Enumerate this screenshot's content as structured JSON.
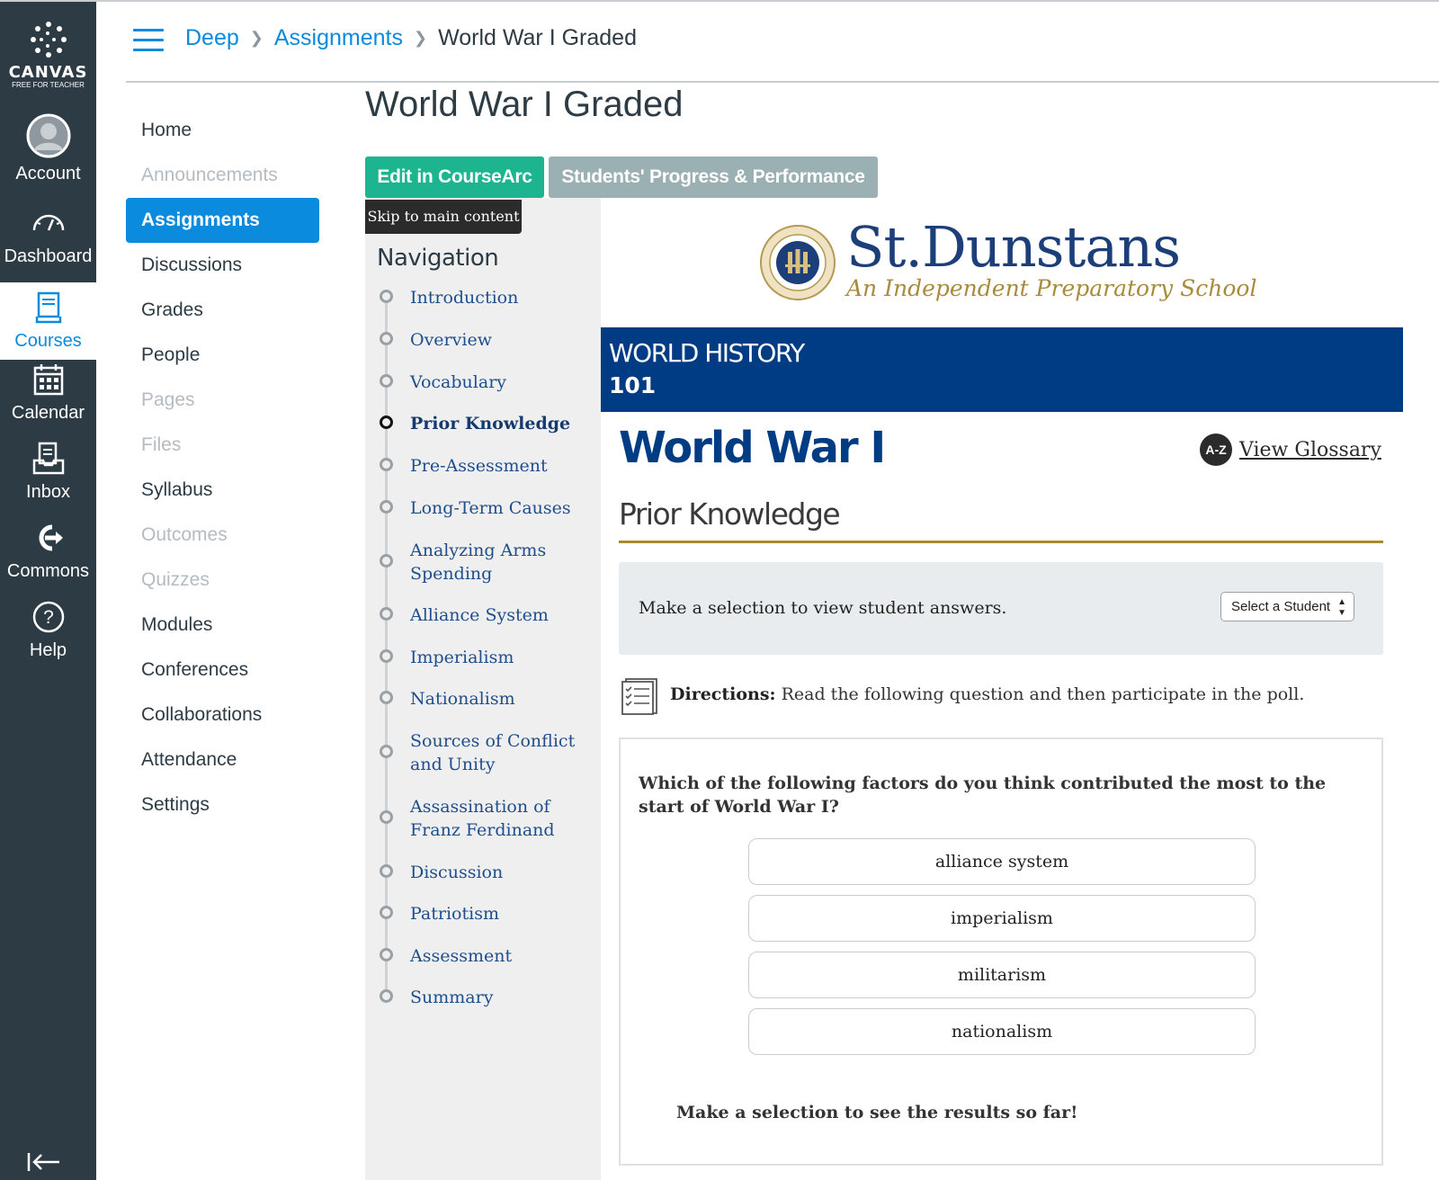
{
  "global_nav": {
    "logo": {
      "word": "CANVAS",
      "sub": "FREE FOR TEACHER"
    },
    "items": [
      {
        "label": "Account",
        "icon": "account-avatar-icon"
      },
      {
        "label": "Dashboard",
        "icon": "dashboard-icon"
      },
      {
        "label": "Courses",
        "icon": "courses-icon",
        "active": true
      },
      {
        "label": "Calendar",
        "icon": "calendar-icon"
      },
      {
        "label": "Inbox",
        "icon": "inbox-icon"
      },
      {
        "label": "Commons",
        "icon": "commons-icon"
      },
      {
        "label": "Help",
        "icon": "help-icon"
      }
    ],
    "collapse_icon": "collapse-nav-icon"
  },
  "breadcrumb": {
    "items": [
      "Deep",
      "Assignments"
    ],
    "current": "World War I Graded"
  },
  "course_nav": {
    "items": [
      {
        "label": "Home"
      },
      {
        "label": "Announcements",
        "disabled": true
      },
      {
        "label": "Assignments",
        "active": true
      },
      {
        "label": "Discussions"
      },
      {
        "label": "Grades"
      },
      {
        "label": "People"
      },
      {
        "label": "Pages",
        "disabled": true
      },
      {
        "label": "Files",
        "disabled": true
      },
      {
        "label": "Syllabus"
      },
      {
        "label": "Outcomes",
        "disabled": true
      },
      {
        "label": "Quizzes",
        "disabled": true
      },
      {
        "label": "Modules"
      },
      {
        "label": "Conferences"
      },
      {
        "label": "Collaborations"
      },
      {
        "label": "Attendance"
      },
      {
        "label": "Settings"
      }
    ]
  },
  "page": {
    "title": "World War I Graded",
    "edit_button": "Edit in CourseArc",
    "progress_button": "Students' Progress & Performance",
    "accent_color": "#1cb58f"
  },
  "lesson_nav": {
    "skip_link": "Skip to main content",
    "heading": "Navigation",
    "items": [
      "Introduction",
      "Overview",
      "Vocabulary",
      "Prior Knowledge",
      "Pre-Assessment",
      "Long-Term Causes",
      "Analyzing Arms Spending",
      "Alliance System",
      "Imperialism",
      "Nationalism",
      "Sources of Conflict and Unity",
      "Assassination of Franz Ferdinand",
      "Discussion",
      "Patriotism",
      "Assessment",
      "Summary"
    ],
    "current": "Prior Knowledge"
  },
  "content": {
    "school": {
      "name": "St.Dunstans",
      "tagline": "An Independent Preparatory School",
      "seal_text": [
        "KNOWLEDGE",
        "SPIRIT",
        "STRENGTH",
        "1891"
      ]
    },
    "banner": {
      "line1": "WORLD HISTORY",
      "line2": "101",
      "color": "#003c84"
    },
    "unit_title": "World War I",
    "glossary": {
      "badge": "A-Z",
      "label": "View Glossary"
    },
    "section_title": "Prior Knowledge",
    "selection": {
      "message": "Make a selection to view student answers.",
      "dropdown": "Select a Student"
    },
    "directions": {
      "label": "Directions:",
      "text": " Read the following question and then participate in the poll."
    },
    "poll": {
      "question": "Which of the following factors do you think contributed the most to the start of World War I?",
      "options": [
        "alliance system",
        "imperialism",
        "militarism",
        "nationalism"
      ],
      "results_note": "Make a selection to see the results so far!"
    }
  }
}
